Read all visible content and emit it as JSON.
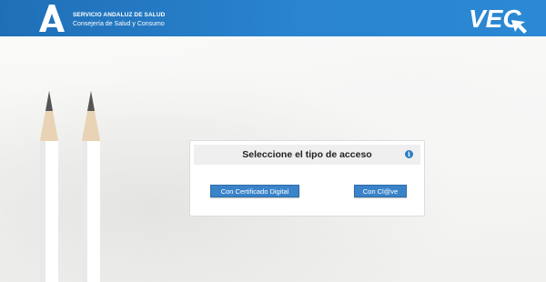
{
  "header": {
    "org_line1": "SERVICIO ANDALUZ DE SALUD",
    "org_line2": "Consejería de Salud y Consumo",
    "brand_logo": "VEC"
  },
  "access_panel": {
    "title": "Seleccione el tipo de acceso",
    "info_icon": "i",
    "buttons": {
      "certificate": "Con Certificado Digital",
      "clave": "Con Cl@ve"
    }
  },
  "colors": {
    "header_blue": "#2a84cf",
    "button_blue": "#3a83c9"
  }
}
